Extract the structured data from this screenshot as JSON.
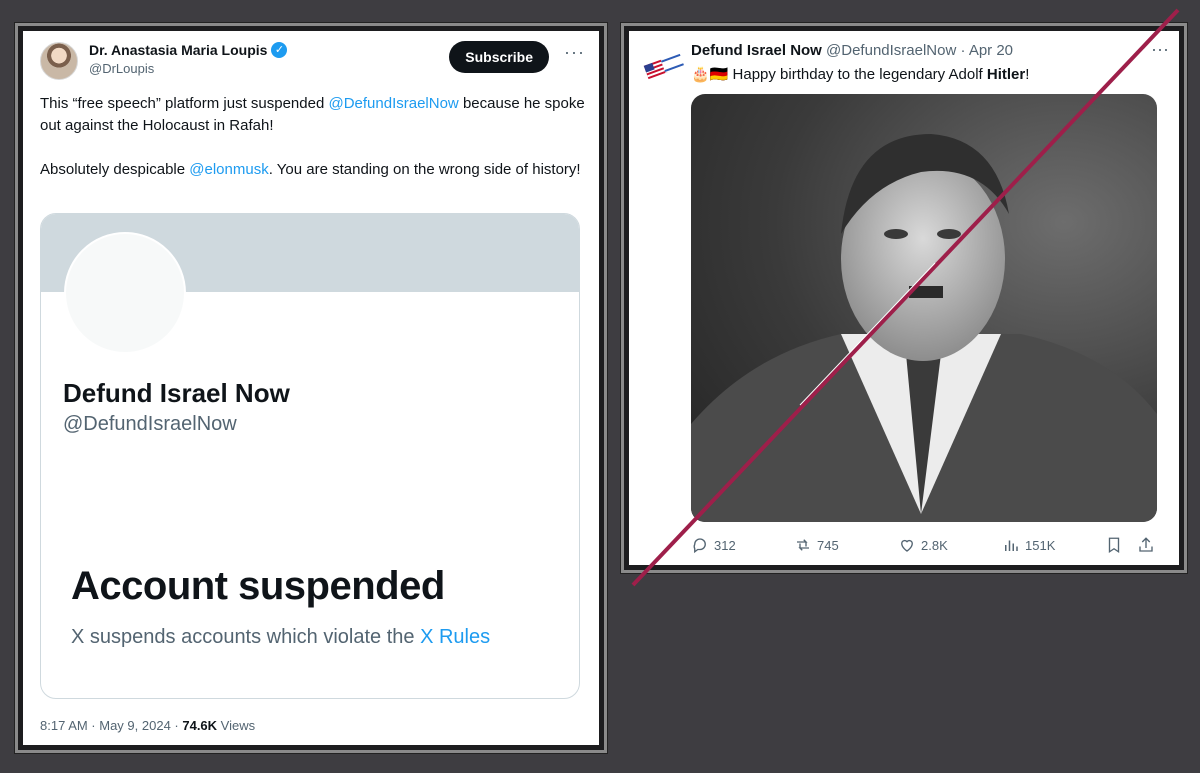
{
  "left_tweet": {
    "author_name": "Dr. Anastasia Maria Loupis",
    "author_handle": "@DrLoupis",
    "subscribe_label": "Subscribe",
    "more_label": "···",
    "verified_mark": "✓",
    "body": {
      "p1_prefix": "This “free speech” platform just suspended ",
      "p1_mention": "@DefundIsraelNow",
      "p1_suffix": " because he spoke out against the Holocaust in Rafah!",
      "p2_prefix": "Absolutely despicable ",
      "p2_mention": "@elonmusk",
      "p2_suffix": ". You are standing on the wrong side of history!"
    },
    "card": {
      "name": "Defund Israel Now",
      "handle": "@DefundIsraelNow",
      "title": "Account suspended",
      "desc_prefix": "X suspends accounts which violate the ",
      "desc_link": "X Rules"
    },
    "meta": {
      "time": "8:17 AM · May 9, 2024 · ",
      "views_count": "74.6K",
      "views_label": " Views"
    }
  },
  "right_tweet": {
    "author_name": "Defund Israel Now",
    "author_handle": "@DefundIsraelNow",
    "date": "· Apr 20",
    "emoji": "🎂🇩🇪",
    "text_prefix": " Happy birthday to the legendary Adolf ",
    "text_bold": "Hitler",
    "text_suffix": "!",
    "more_label": "···",
    "actions": {
      "replies": "312",
      "reposts": "745",
      "likes": "2.8K",
      "views": "151K"
    }
  },
  "colors": {
    "accent": "#1d9bf0",
    "background": "#3e3d41",
    "strike": "#9e1f4a"
  },
  "icons": [
    "verified-icon",
    "more-icon",
    "reply-icon",
    "repost-icon",
    "like-icon",
    "views-icon",
    "bookmark-icon",
    "share-icon"
  ]
}
